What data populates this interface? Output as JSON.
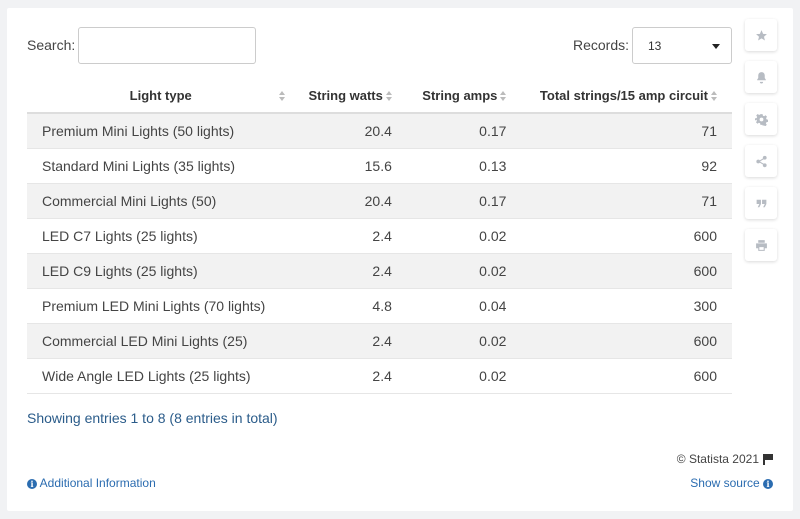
{
  "search": {
    "label": "Search:",
    "value": ""
  },
  "records": {
    "label": "Records:",
    "value": "13"
  },
  "table": {
    "columns": [
      "Light type",
      "String watts",
      "String amps",
      "Total strings/15 amp circuit"
    ],
    "rows": [
      [
        "Premium Mini Lights (50 lights)",
        "20.4",
        "0.17",
        "71"
      ],
      [
        "Standard Mini Lights (35 lights)",
        "15.6",
        "0.13",
        "92"
      ],
      [
        "Commercial Mini Lights (50)",
        "20.4",
        "0.17",
        "71"
      ],
      [
        "LED C7 Lights (25 lights)",
        "2.4",
        "0.02",
        "600"
      ],
      [
        "LED C9 Lights (25 lights)",
        "2.4",
        "0.02",
        "600"
      ],
      [
        "Premium LED Mini Lights (70 lights)",
        "4.8",
        "0.04",
        "300"
      ],
      [
        "Commercial LED Mini Lights (25)",
        "2.4",
        "0.02",
        "600"
      ],
      [
        "Wide Angle LED Lights (25 lights)",
        "2.4",
        "0.02",
        "600"
      ]
    ]
  },
  "footer": {
    "entries": "Showing entries 1 to 8 (8 entries in total)",
    "copyright": "© Statista 2021",
    "additional_info": "Additional Information",
    "show_source": "Show source"
  },
  "sidebar": {
    "icons": [
      "star-icon",
      "bell-icon",
      "gear-icon",
      "share-icon",
      "quote-icon",
      "print-icon"
    ]
  },
  "colors": {
    "link": "#2b6cb0",
    "stripe": "#f2f2f2",
    "icon": "#b7bcc3"
  }
}
